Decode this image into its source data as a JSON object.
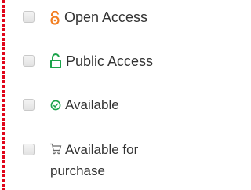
{
  "filters": [
    {
      "label": "Open Access",
      "icon": "open-lock-icon",
      "icon_color": "#f27e22",
      "checked": false
    },
    {
      "label": "Public Access",
      "icon": "unlocked-padlock-icon",
      "icon_color": "#1aa34a",
      "checked": false
    },
    {
      "label": "Available",
      "icon": "check-circle-icon",
      "icon_color": "#1aa34a",
      "checked": false
    },
    {
      "label_line1": "Available for",
      "label_line2": "purchase",
      "icon": "cart-icon",
      "icon_color": "#666666",
      "checked": false
    }
  ],
  "colors": {
    "border_dash": "#e0061a",
    "text": "#333333",
    "checkbox_border": "#c9c9c9"
  }
}
